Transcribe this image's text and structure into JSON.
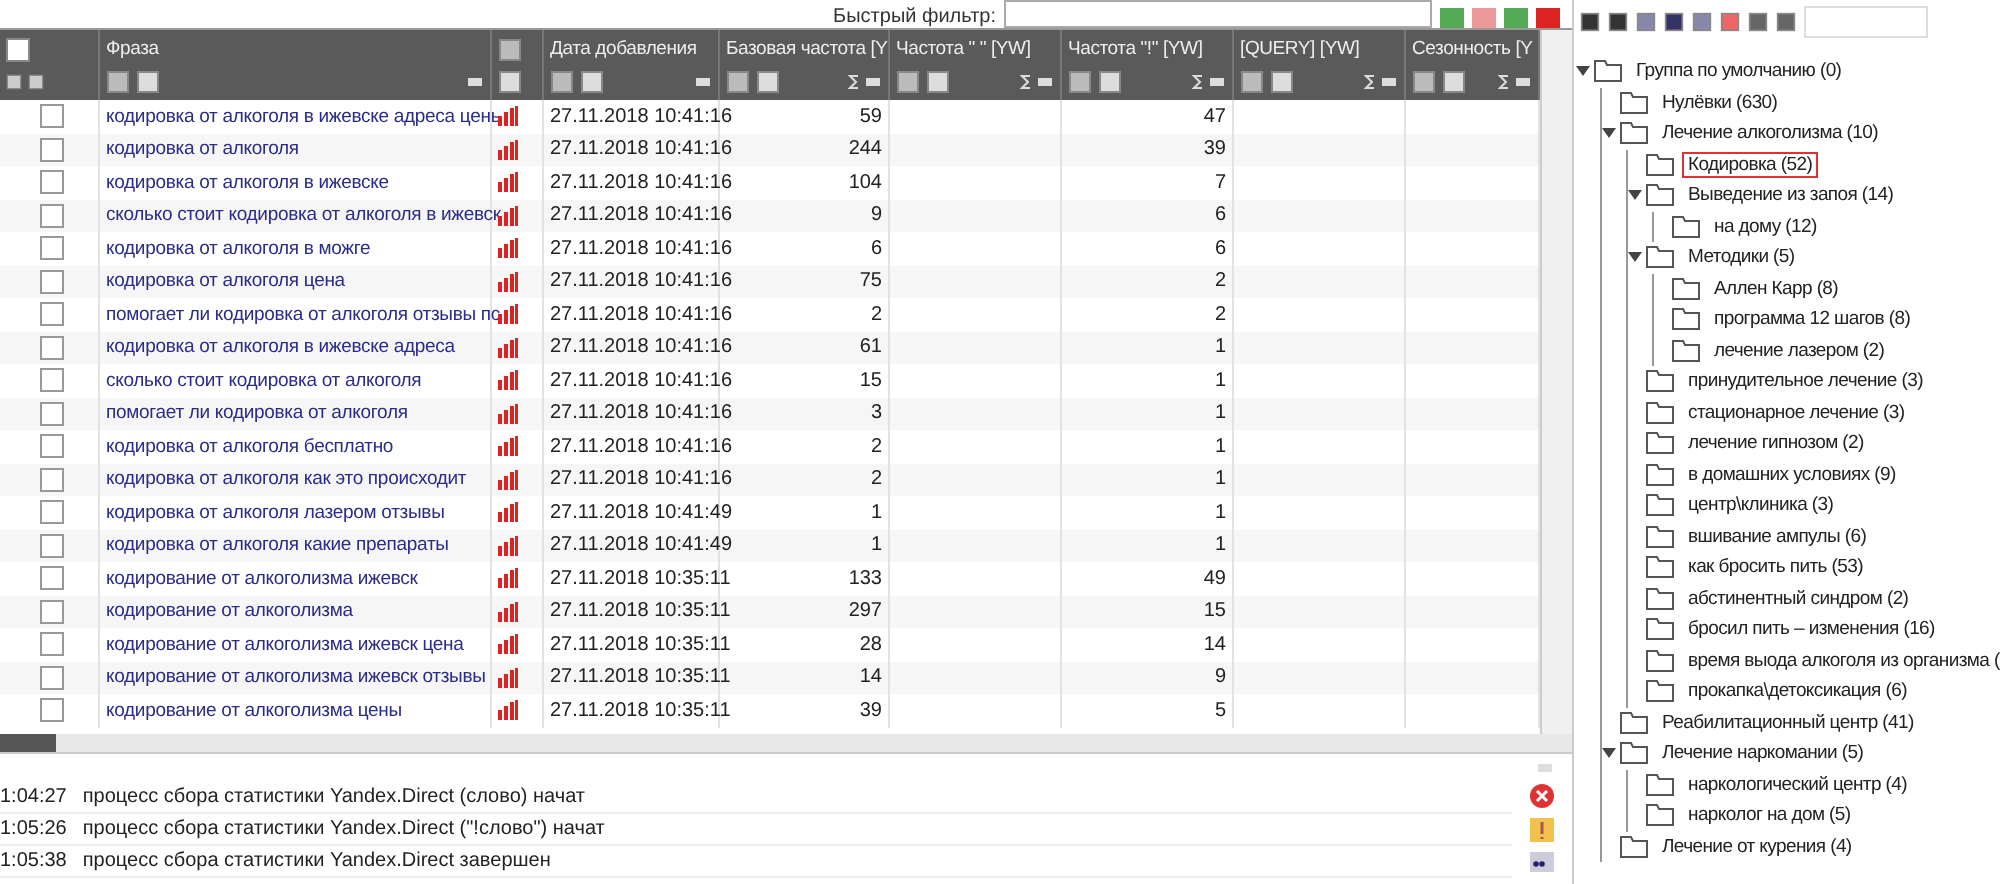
{
  "filter": {
    "label": "Быстрый фильтр:"
  },
  "select_all": {
    "checked": false
  },
  "columns": [
    {
      "title": "Фраза",
      "kind": "text"
    },
    {
      "title": "Дата добавления",
      "kind": "date"
    },
    {
      "title": "Базовая частота [Y",
      "kind": "num"
    },
    {
      "title": "Частота \" \" [YW]",
      "kind": "num"
    },
    {
      "title": "Частота \"!\" [YW]",
      "kind": "num"
    },
    {
      "title": "[QUERY] [YW]",
      "kind": "num"
    },
    {
      "title": "Сезонность [Y",
      "kind": "num"
    }
  ],
  "rows": [
    {
      "checked": false,
      "phrase": "кодировка от алкоголя в ижевске адреса цень",
      "date": "27.11.2018 10:41:16",
      "base": "59",
      "excl": "47"
    },
    {
      "checked": false,
      "phrase": "кодировка от алкоголя",
      "date": "27.11.2018 10:41:16",
      "base": "244",
      "excl": "39"
    },
    {
      "checked": false,
      "phrase": "кодировка от алкоголя в ижевске",
      "date": "27.11.2018 10:41:16",
      "base": "104",
      "excl": "7"
    },
    {
      "checked": false,
      "phrase": "сколько стоит кодировка от алкоголя в ижевск",
      "date": "27.11.2018 10:41:16",
      "base": "9",
      "excl": "6"
    },
    {
      "checked": false,
      "phrase": "кодировка от алкоголя в можге",
      "date": "27.11.2018 10:41:16",
      "base": "6",
      "excl": "6"
    },
    {
      "checked": false,
      "phrase": "кодировка от алкоголя цена",
      "date": "27.11.2018 10:41:16",
      "base": "75",
      "excl": "2"
    },
    {
      "checked": false,
      "phrase": "помогает ли кодировка от алкоголя отзывы пс",
      "date": "27.11.2018 10:41:16",
      "base": "2",
      "excl": "2"
    },
    {
      "checked": false,
      "phrase": "кодировка от алкоголя в ижевске адреса",
      "date": "27.11.2018 10:41:16",
      "base": "61",
      "excl": "1"
    },
    {
      "checked": false,
      "phrase": "сколько стоит кодировка от алкоголя",
      "date": "27.11.2018 10:41:16",
      "base": "15",
      "excl": "1"
    },
    {
      "checked": false,
      "phrase": "помогает ли кодировка от алкоголя",
      "date": "27.11.2018 10:41:16",
      "base": "3",
      "excl": "1"
    },
    {
      "checked": false,
      "phrase": "кодировка от алкоголя бесплатно",
      "date": "27.11.2018 10:41:16",
      "base": "2",
      "excl": "1"
    },
    {
      "checked": false,
      "phrase": "кодировка от алкоголя как это происходит",
      "date": "27.11.2018 10:41:16",
      "base": "2",
      "excl": "1"
    },
    {
      "checked": false,
      "phrase": "кодировка от алкоголя лазером отзывы",
      "date": "27.11.2018 10:41:49",
      "base": "1",
      "excl": "1"
    },
    {
      "checked": false,
      "phrase": "кодировка от алкоголя какие препараты",
      "date": "27.11.2018 10:41:49",
      "base": "1",
      "excl": "1"
    },
    {
      "checked": false,
      "phrase": "кодирование от алкоголизма ижевск",
      "date": "27.11.2018 10:35:11",
      "base": "133",
      "excl": "49"
    },
    {
      "checked": false,
      "phrase": "кодирование от алкоголизма",
      "date": "27.11.2018 10:35:11",
      "base": "297",
      "excl": "15"
    },
    {
      "checked": false,
      "phrase": "кодирование от алкоголизма ижевск цена",
      "date": "27.11.2018 10:35:11",
      "base": "28",
      "excl": "14"
    },
    {
      "checked": false,
      "phrase": "кодирование от алкоголизма ижевск отзывы",
      "date": "27.11.2018 10:35:11",
      "base": "14",
      "excl": "9"
    },
    {
      "checked": false,
      "phrase": "кодирование от алкоголизма цены",
      "date": "27.11.2018 10:35:11",
      "base": "39",
      "excl": "5"
    }
  ],
  "log": [
    {
      "time": "1:04:27",
      "text": "процесс сбора статистики Yandex.Direct (слово) начат"
    },
    {
      "time": "1:05:26",
      "text": "процесс сбора статистики Yandex.Direct (\"!слово\") начат"
    },
    {
      "time": "1:05:38",
      "text": "процесс сбора статистики Yandex.Direct завершен"
    }
  ],
  "tree": [
    {
      "label": "Группа по умолчанию (0)",
      "selected": false,
      "expanded": true,
      "children": [
        {
          "label": "Нулёвки (630)",
          "selected": false,
          "expanded": false
        },
        {
          "label": "Лечение алкоголизма (10)",
          "selected": false,
          "expanded": true,
          "children": [
            {
              "label": "Кодировка (52)",
              "selected": true,
              "expanded": false
            },
            {
              "label": "Выведение из запоя (14)",
              "selected": false,
              "expanded": true,
              "children": [
                {
                  "label": "на дому (12)",
                  "selected": false,
                  "expanded": false
                }
              ]
            },
            {
              "label": "Методики (5)",
              "selected": false,
              "expanded": true,
              "children": [
                {
                  "label": "Аллен Карр (8)",
                  "selected": false,
                  "expanded": false
                },
                {
                  "label": "программа 12 шагов (8)",
                  "selected": false,
                  "expanded": false
                },
                {
                  "label": "лечение лазером (2)",
                  "selected": false,
                  "expanded": false
                }
              ]
            },
            {
              "label": "принудительное лечение (3)",
              "selected": false,
              "expanded": false
            },
            {
              "label": "стационарное лечение (3)",
              "selected": false,
              "expanded": false
            },
            {
              "label": "лечение гипнозом (2)",
              "selected": false,
              "expanded": false
            },
            {
              "label": "в домашних условиях (9)",
              "selected": false,
              "expanded": false
            },
            {
              "label": "центр\\клиника (3)",
              "selected": false,
              "expanded": false
            },
            {
              "label": "вшивание ампулы (6)",
              "selected": false,
              "expanded": false
            },
            {
              "label": "как бросить пить (53)",
              "selected": false,
              "expanded": false
            },
            {
              "label": "абстинентный синдром (2)",
              "selected": false,
              "expanded": false
            },
            {
              "label": "бросил пить – изменения (16)",
              "selected": false,
              "expanded": false
            },
            {
              "label": "время выода алкоголя из организма (",
              "selected": false,
              "expanded": false
            },
            {
              "label": "прокапка\\детоксикация (6)",
              "selected": false,
              "expanded": false
            }
          ]
        },
        {
          "label": "Реабилитационный центр (41)",
          "selected": false,
          "expanded": false
        },
        {
          "label": "Лечение наркомании (5)",
          "selected": false,
          "expanded": true,
          "children": [
            {
              "label": "наркологический центр (4)",
              "selected": false,
              "expanded": false
            },
            {
              "label": "нарколог на дом (5)",
              "selected": false,
              "expanded": false
            }
          ]
        },
        {
          "label": "Лечение от курения (4)",
          "selected": false,
          "expanded": false
        }
      ]
    }
  ]
}
